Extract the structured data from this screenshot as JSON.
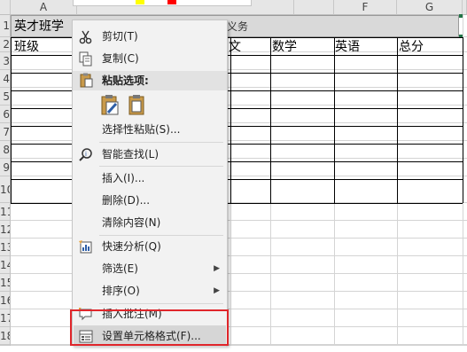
{
  "columns": [
    "A",
    "E",
    "F",
    "G"
  ],
  "rows": [
    "1",
    "2",
    "3",
    "4",
    "5",
    "6",
    "7",
    "8",
    "9",
    "10",
    "11",
    "12",
    "13",
    "14",
    "15",
    "16",
    "17",
    "18",
    "19"
  ],
  "cells": {
    "a1": "英才班学",
    "a1_overflow": "习成绩登记",
    "a2": "班级",
    "d2_partial": "文",
    "e2": "数学",
    "f2": "英语",
    "g2": "总分"
  },
  "menu": {
    "cut": "剪切(T)",
    "copy": "复制(C)",
    "paste_options": "粘贴选项:",
    "paste_special": "选择性粘贴(S)...",
    "smart_lookup": "智能查找(L)",
    "insert": "插入(I)...",
    "delete": "删除(D)...",
    "clear": "清除内容(N)",
    "quick_analysis": "快速分析(Q)",
    "filter": "筛选(E)",
    "sort": "排序(O)",
    "insert_comment": "插入批注(M)",
    "format_cells": "设置单元格格式(F)..."
  },
  "colors": {
    "highlight_box": "#e0262b",
    "header_bg": "#e6e6e6",
    "menu_bg": "#f2f2f2"
  }
}
